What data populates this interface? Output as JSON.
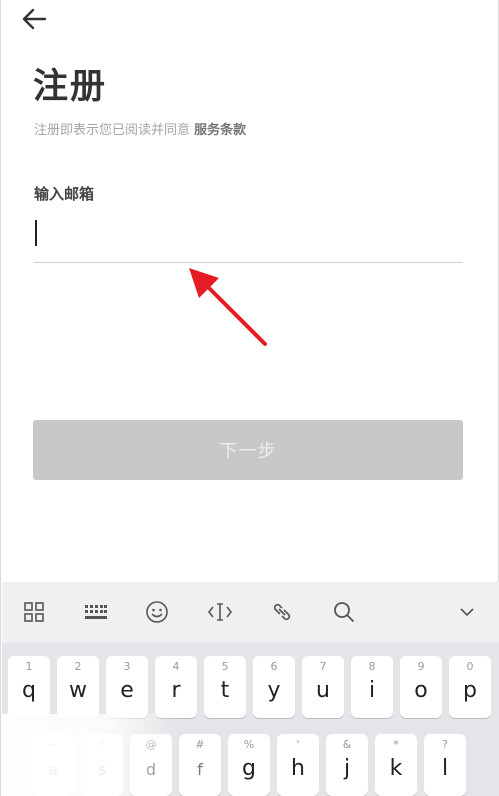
{
  "header": {
    "back_icon": "arrow-left-icon"
  },
  "page": {
    "title": "注册",
    "agreement_prefix": "注册即表示您已阅读并同意",
    "agreement_link": "服务条款"
  },
  "form": {
    "email_label": "输入邮箱",
    "email_value": "",
    "email_placeholder": ""
  },
  "actions": {
    "next_label": "下一步"
  },
  "annotation": {
    "arrow_color": "#e51c23"
  },
  "keyboard": {
    "toolbar": [
      "grid-icon",
      "keyboard-icon",
      "emoji-icon",
      "text-cursor-icon",
      "link-icon",
      "search-icon",
      "chevron-down-icon"
    ],
    "row1": [
      {
        "hint": "1",
        "key": "q"
      },
      {
        "hint": "2",
        "key": "w"
      },
      {
        "hint": "3",
        "key": "e"
      },
      {
        "hint": "4",
        "key": "r"
      },
      {
        "hint": "5",
        "key": "t"
      },
      {
        "hint": "6",
        "key": "y"
      },
      {
        "hint": "7",
        "key": "u"
      },
      {
        "hint": "8",
        "key": "i"
      },
      {
        "hint": "9",
        "key": "o"
      },
      {
        "hint": "0",
        "key": "p"
      }
    ],
    "row2": [
      {
        "hint": "~",
        "key": "a"
      },
      {
        "hint": "!",
        "key": "s"
      },
      {
        "hint": "@",
        "key": "d"
      },
      {
        "hint": "#",
        "key": "f"
      },
      {
        "hint": "%",
        "key": "g"
      },
      {
        "hint": "'",
        "key": "h"
      },
      {
        "hint": "&",
        "key": "j"
      },
      {
        "hint": "*",
        "key": "k"
      },
      {
        "hint": "?",
        "key": "l"
      }
    ]
  },
  "colors": {
    "button_disabled": "#c8c8c8",
    "title": "#333333",
    "muted_text": "#a5a5a5"
  }
}
